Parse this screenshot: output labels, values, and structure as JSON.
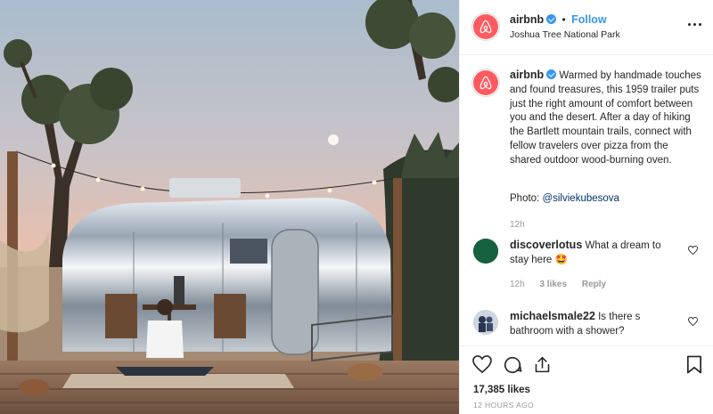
{
  "account": {
    "username": "airbnb",
    "separator": "•",
    "follow_label": "Follow",
    "location": "Joshua Tree National Park",
    "avatar_icon": "airbnb-logo-icon",
    "brand_color": "#ff5a5f"
  },
  "caption": {
    "username": "airbnb",
    "text": "Warmed by handmade touches and found treasures, this 1959 trailer puts just the right amount of comfort between you and the desert. After a day of hiking the Bartlett mountain trails, connect with fellow travelers over pizza from the shared outdoor wood-burning oven.",
    "photo_prefix": "Photo: ",
    "photo_credit": "@silviekubesova",
    "time": "12h"
  },
  "comments": [
    {
      "username": "discoverlotus",
      "text": "What a dream to stay here 🤩",
      "time": "12h",
      "likes": "3 likes",
      "reply": "Reply"
    },
    {
      "username": "michaelsmale22",
      "text": "Is there s bathroom with a shower?"
    }
  ],
  "actions": {
    "like_icon": "heart-icon",
    "comment_icon": "comment-icon",
    "share_icon": "share-icon",
    "save_icon": "bookmark-icon"
  },
  "likes_count": "17,385 likes",
  "posted": "12 HOURS AGO",
  "colors": {
    "link": "#3897f0",
    "verified": "#3897f0",
    "muted": "#999999",
    "mention": "#003569"
  }
}
